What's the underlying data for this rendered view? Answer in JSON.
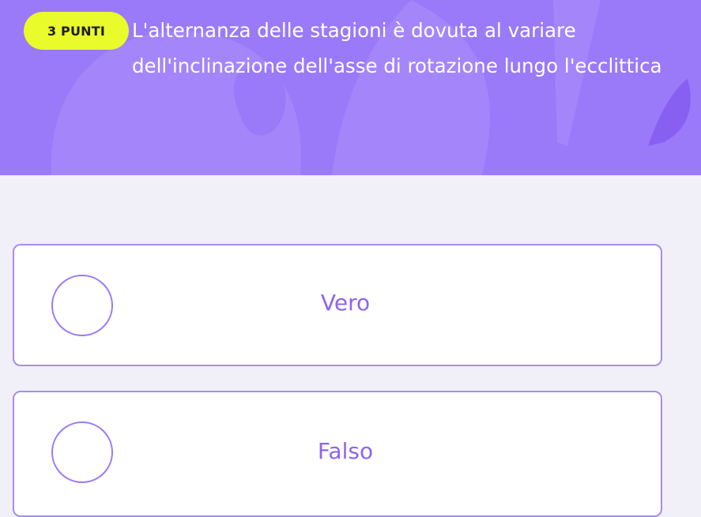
{
  "quiz": {
    "points_badge": "3 PUNTI",
    "question": "L'alternanza delle stagioni è dovuta al variare dell'inclinazione dell'asse di rotazione  lungo l'ecclittica",
    "answers": [
      {
        "label": "Vero"
      },
      {
        "label": "Falso"
      }
    ]
  },
  "colors": {
    "header_background": "#9a7af9",
    "badge_background": "#e9fb2a",
    "accent": "#8d64f2",
    "page_background": "#f1f0f8"
  }
}
